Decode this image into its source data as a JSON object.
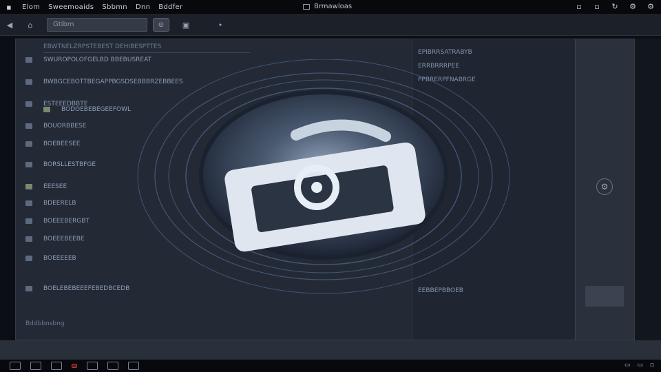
{
  "app": {
    "menu": [
      "Elom",
      "Sweemoaids",
      "Sbbmn",
      "Dnn",
      "Bddfer"
    ],
    "window_title": "Brmawloas"
  },
  "toolbar": {
    "address_value": "Gtibm"
  },
  "list": {
    "header": "EBWTNELZRPSTEBEST DEHIBESPTTES",
    "rows": [
      {
        "label": "SWUROPOLOFGELBD  BBEBUSREAT",
        "green": false
      },
      {
        "label": "BWBGCEBOTTBEGAPPBGSDSEBBBRZEBBEES",
        "green": false
      },
      {
        "label": "ESTEEEDBBTE",
        "green": false
      },
      {
        "label": "BODOEBEBEGEEFOWL",
        "green": true
      },
      {
        "label": "BOUORBBESE",
        "green": false
      },
      {
        "label": "BOEBEESEE",
        "green": false
      },
      {
        "label": "BORSLLESTBFGE",
        "green": false
      },
      {
        "label": "EEESEE",
        "green": true
      },
      {
        "label": "BDEERELB",
        "green": false
      },
      {
        "label": "BOEEEBERGBT",
        "green": false
      },
      {
        "label": "BOEEEBEEBE",
        "green": false
      },
      {
        "label": "BOEEEEEB",
        "green": false
      },
      {
        "label": "BOELEBEBEEEFEBEDBCEDB",
        "green": false
      }
    ],
    "status": "Bddbbnsbng"
  },
  "detail": {
    "lines": [
      "EPIBRRSATRABYB",
      "ERRBRRRPEE",
      "PPBRERPFNABRGE",
      "EEBBEPBBOEB"
    ]
  },
  "colors": {
    "icon_ring": "#5b7aa8",
    "icon_glow": "#8fa8c8",
    "background": "#232a36"
  },
  "icons": {
    "center": "camera-sync-icon",
    "settings": "gear-icon"
  }
}
